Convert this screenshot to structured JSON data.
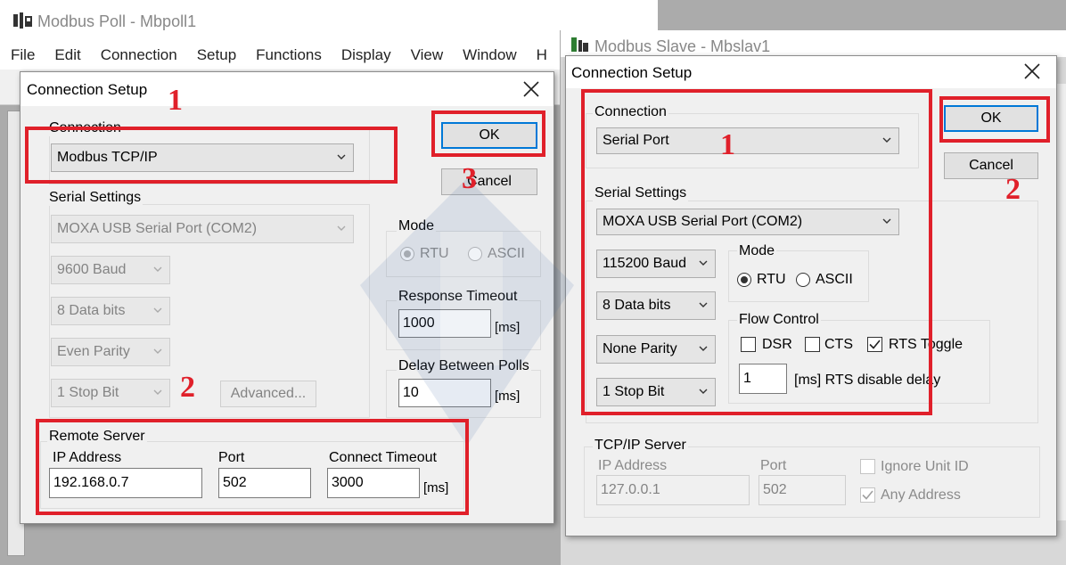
{
  "poll_window": {
    "title": "Modbus Poll - Mbpoll1",
    "menu": [
      "File",
      "Edit",
      "Connection",
      "Setup",
      "Functions",
      "Display",
      "View",
      "Window",
      "H"
    ]
  },
  "slave_window": {
    "title": "Modbus Slave - Mbslav1"
  },
  "poll_dialog": {
    "title": "Connection Setup",
    "connection_label": "Connection",
    "connection_value": "Modbus TCP/IP",
    "ok": "OK",
    "cancel": "Cancel",
    "serial_settings_label": "Serial Settings",
    "port": "MOXA USB Serial Port (COM2)",
    "baud": "9600 Baud",
    "data_bits": "8 Data bits",
    "parity": "Even Parity",
    "stop_bit": "1 Stop Bit",
    "advanced": "Advanced...",
    "mode_label": "Mode",
    "rtu": "RTU",
    "ascii": "ASCII",
    "response_timeout_label": "Response Timeout",
    "response_timeout": "1000",
    "ms": "[ms]",
    "delay_label": "Delay Between Polls",
    "delay": "10",
    "remote_server_label": "Remote Server",
    "ip_label": "IP Address",
    "ip": "192.168.0.7",
    "port_label": "Port",
    "port_value": "502",
    "connect_timeout_label": "Connect Timeout",
    "connect_timeout": "3000",
    "mode_selected": "RTU"
  },
  "slave_dialog": {
    "title": "Connection Setup",
    "connection_label": "Connection",
    "connection_value": "Serial Port",
    "ok": "OK",
    "cancel": "Cancel",
    "serial_settings_label": "Serial Settings",
    "port": "MOXA USB Serial Port (COM2)",
    "baud": "115200 Baud",
    "data_bits": "8 Data bits",
    "parity": "None Parity",
    "stop_bit": "1 Stop Bit",
    "mode_label": "Mode",
    "rtu": "RTU",
    "ascii": "ASCII",
    "mode_selected": "RTU",
    "flow_control_label": "Flow Control",
    "dsr": "DSR",
    "cts": "CTS",
    "rts_toggle": "RTS Toggle",
    "dsr_checked": false,
    "cts_checked": false,
    "rts_toggle_checked": true,
    "rts_delay": "1",
    "rts_delay_label": "[ms] RTS disable delay",
    "tcp_server_label": "TCP/IP Server",
    "ip_label": "IP Address",
    "ip": "127.0.0.1",
    "port_label": "Port",
    "port_value": "502",
    "ignore_unit_id": "Ignore Unit ID",
    "any_address": "Any Address",
    "ignore_unit_id_checked": false,
    "any_address_checked": true
  },
  "annotations": {
    "left_1": "1",
    "left_2": "2",
    "left_3": "3",
    "right_1": "1",
    "right_2": "2",
    "color": "#e0202a"
  }
}
